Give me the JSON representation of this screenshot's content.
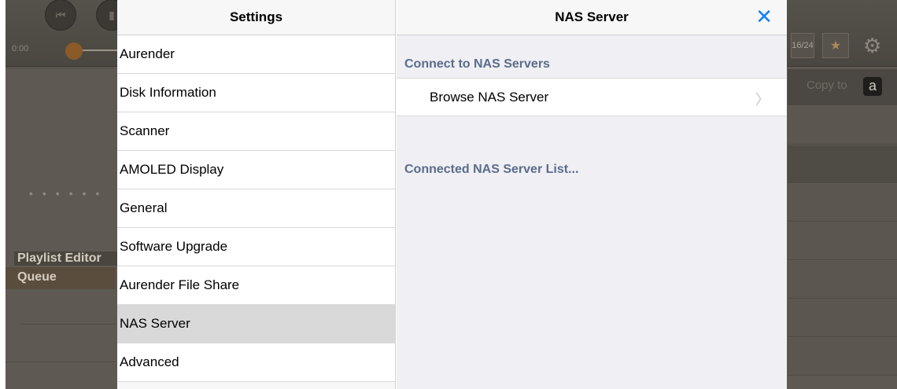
{
  "background": {
    "time": "0:00",
    "counter": "16/24",
    "copy_to": "Copy to",
    "amazon_letter": "a",
    "playlist_editor": "Playlist Editor",
    "queue": "Queue"
  },
  "settings": {
    "title": "Settings",
    "items": [
      {
        "label": "Aurender"
      },
      {
        "label": "Disk Information"
      },
      {
        "label": "Scanner"
      },
      {
        "label": "AMOLED Display"
      },
      {
        "label": "General"
      },
      {
        "label": "Software Upgrade"
      },
      {
        "label": "Aurender File Share"
      },
      {
        "label": "NAS Server"
      },
      {
        "label": "Advanced"
      }
    ],
    "selected": "NAS Server"
  },
  "detail": {
    "title": "NAS Server",
    "close": "✕",
    "section1": "Connect to NAS Servers",
    "browse_label": "Browse NAS Server",
    "chevron": "〉",
    "section2": "Connected NAS Server List..."
  },
  "colors": {
    "accent": "#147efb",
    "section_header": "#5b6c8a",
    "selected_row": "#d9d9d9"
  }
}
